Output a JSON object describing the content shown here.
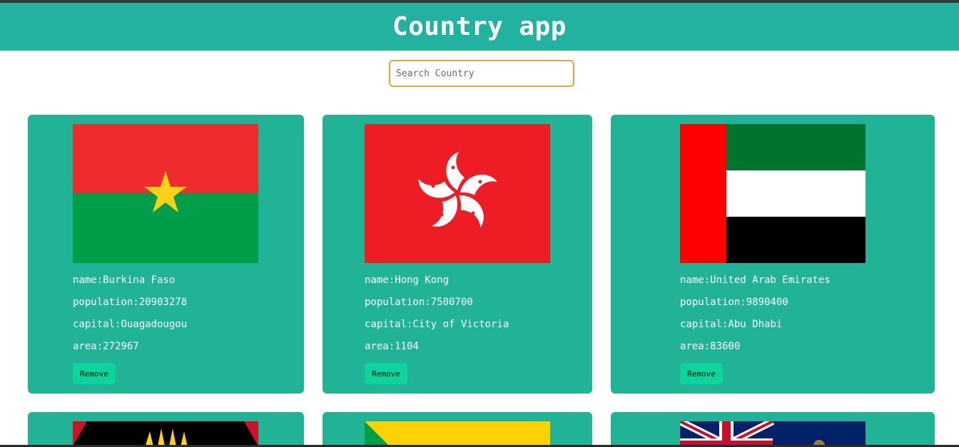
{
  "header": {
    "title": "Country app"
  },
  "search": {
    "placeholder": "Search Country",
    "value": ""
  },
  "cards": [
    {
      "name": "name:Burkina Faso",
      "population": "population:20903278",
      "capital": "capital:Ouagadougou",
      "area": "area:272967",
      "remove_label": "Remove",
      "flag": "burkina-faso-flag"
    },
    {
      "name": "name:Hong Kong",
      "population": "population:7500700",
      "capital": "capital:City of Victoria",
      "area": "area:1104",
      "remove_label": "Remove",
      "flag": "hong-kong-flag"
    },
    {
      "name": "name:United Arab Emirates",
      "population": "population:9890400",
      "capital": "capital:Abu Dhabi",
      "area": "area:83600",
      "remove_label": "Remove",
      "flag": "uae-flag"
    },
    {
      "flag": "antigua-and-barbuda-flag"
    },
    {
      "flag": "guyana-flag"
    },
    {
      "flag": "blue-ensign-flag"
    }
  ],
  "colors": {
    "header_bg": "#22b3a0",
    "card_bg": "#21b396",
    "button_bg": "#0dd39c",
    "search_border": "#e8a33a"
  }
}
